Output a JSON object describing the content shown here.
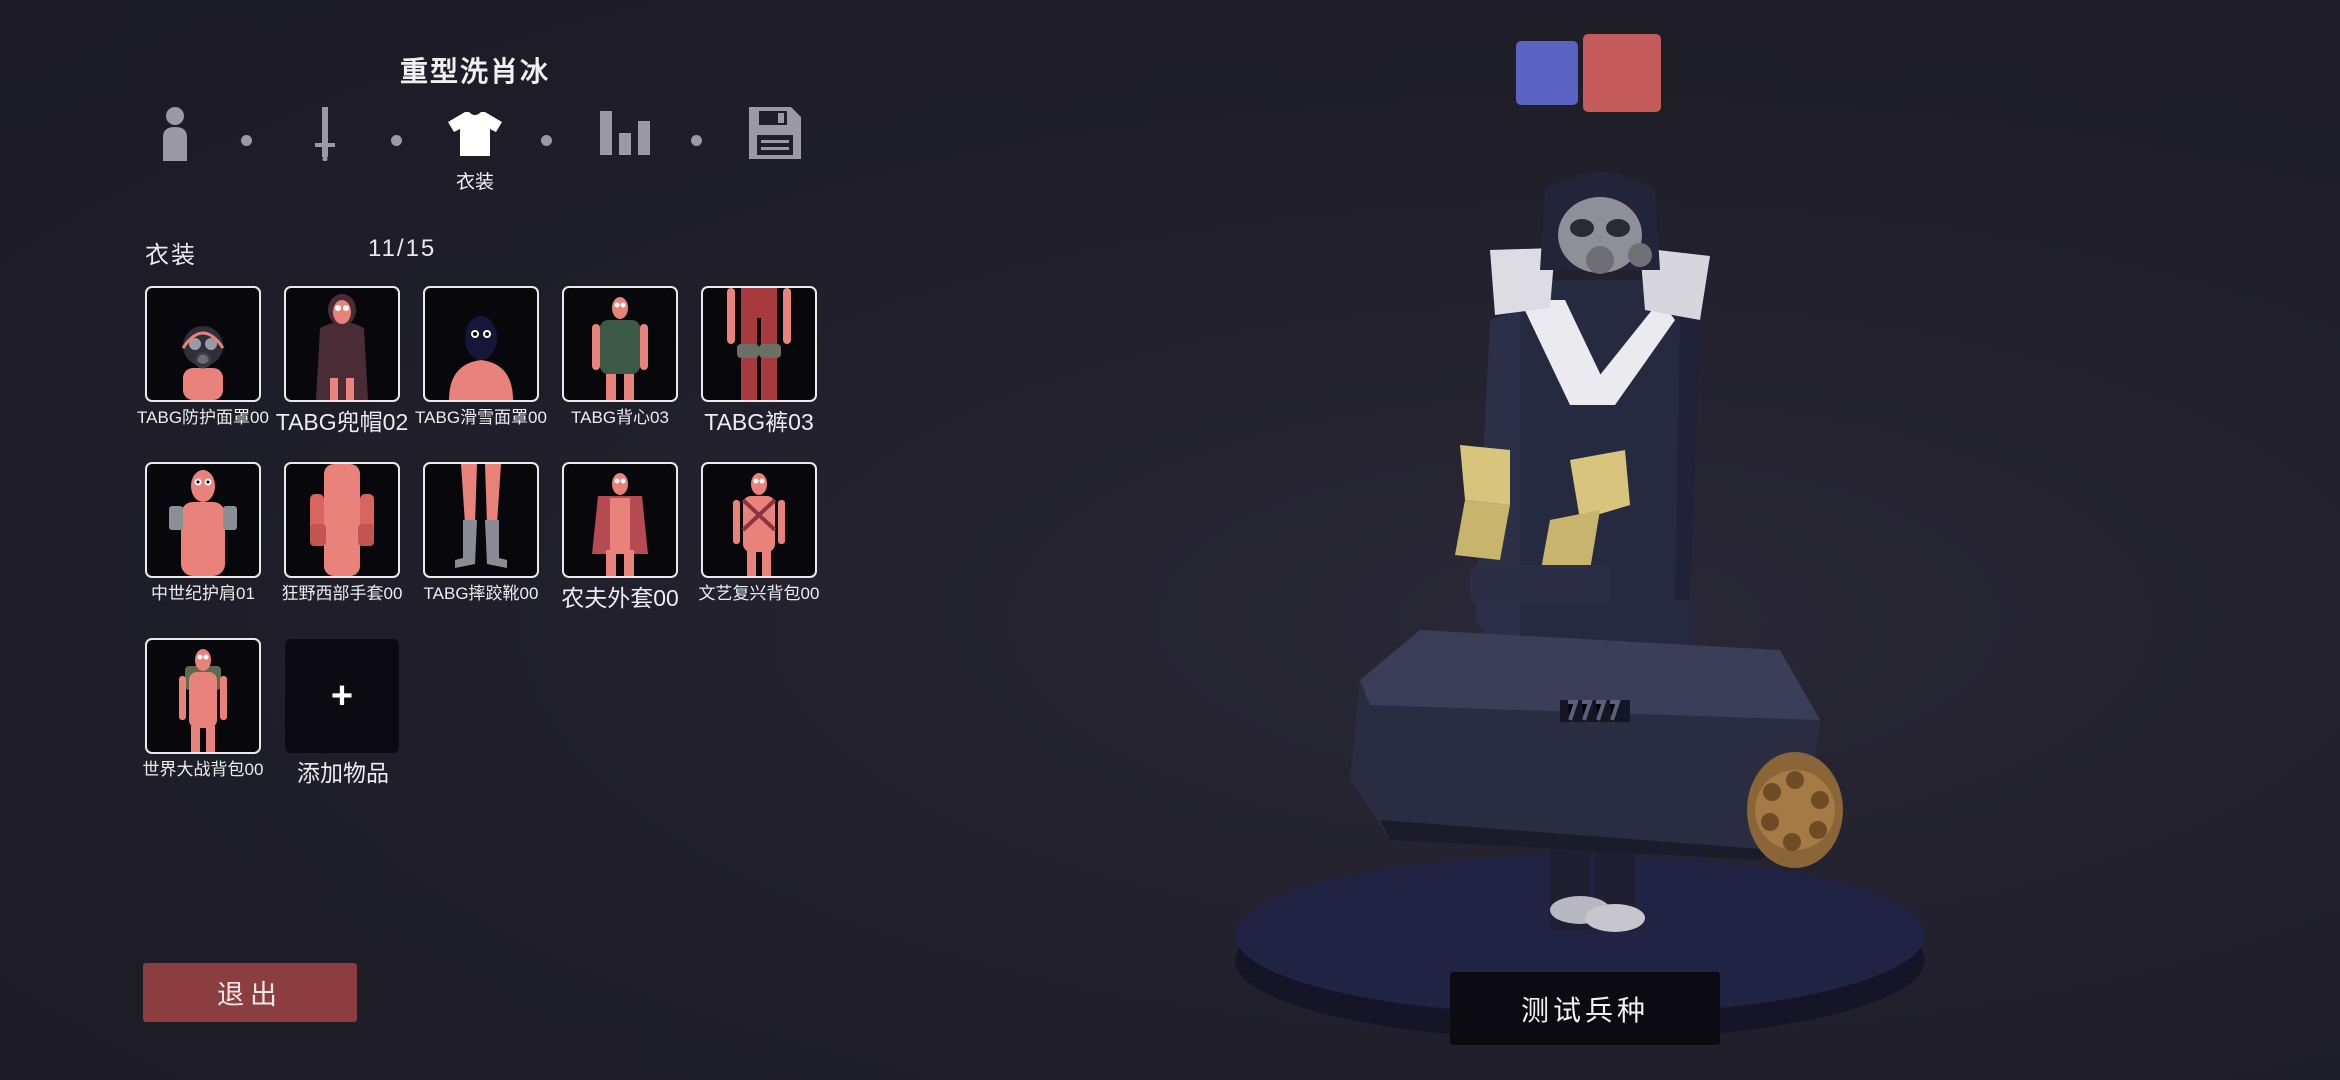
{
  "unit_name": "重型洗肖冰",
  "steps": [
    {
      "icon": "person-icon",
      "label": ""
    },
    {
      "icon": "sword-icon",
      "label": ""
    },
    {
      "icon": "shirt-icon",
      "label": "衣装",
      "active": true
    },
    {
      "icon": "stats-icon",
      "label": ""
    },
    {
      "icon": "save-icon",
      "label": ""
    }
  ],
  "section": {
    "label": "衣装",
    "count": "11/15"
  },
  "items": [
    {
      "name": "TABG防护面罩00"
    },
    {
      "name": "TABG兜帽02"
    },
    {
      "name": "TABG滑雪面罩00"
    },
    {
      "name": "TABG背心03"
    },
    {
      "name": "TABG裤03"
    },
    {
      "name": "中世纪护肩01"
    },
    {
      "name": "狂野西部手套00"
    },
    {
      "name": "TABG摔跤靴00"
    },
    {
      "name": "农夫外套00"
    },
    {
      "name": "文艺复兴背包00"
    },
    {
      "name": "世界大战背包00"
    }
  ],
  "add_item": {
    "icon": "+",
    "label": "添加物品"
  },
  "exit_label": "退出",
  "test_label": "测试兵种",
  "colors": {
    "team_blue": "#5a63c4",
    "team_red": "#c45a5a",
    "exit": "#8c3d3f",
    "skin": "#e9827a"
  }
}
